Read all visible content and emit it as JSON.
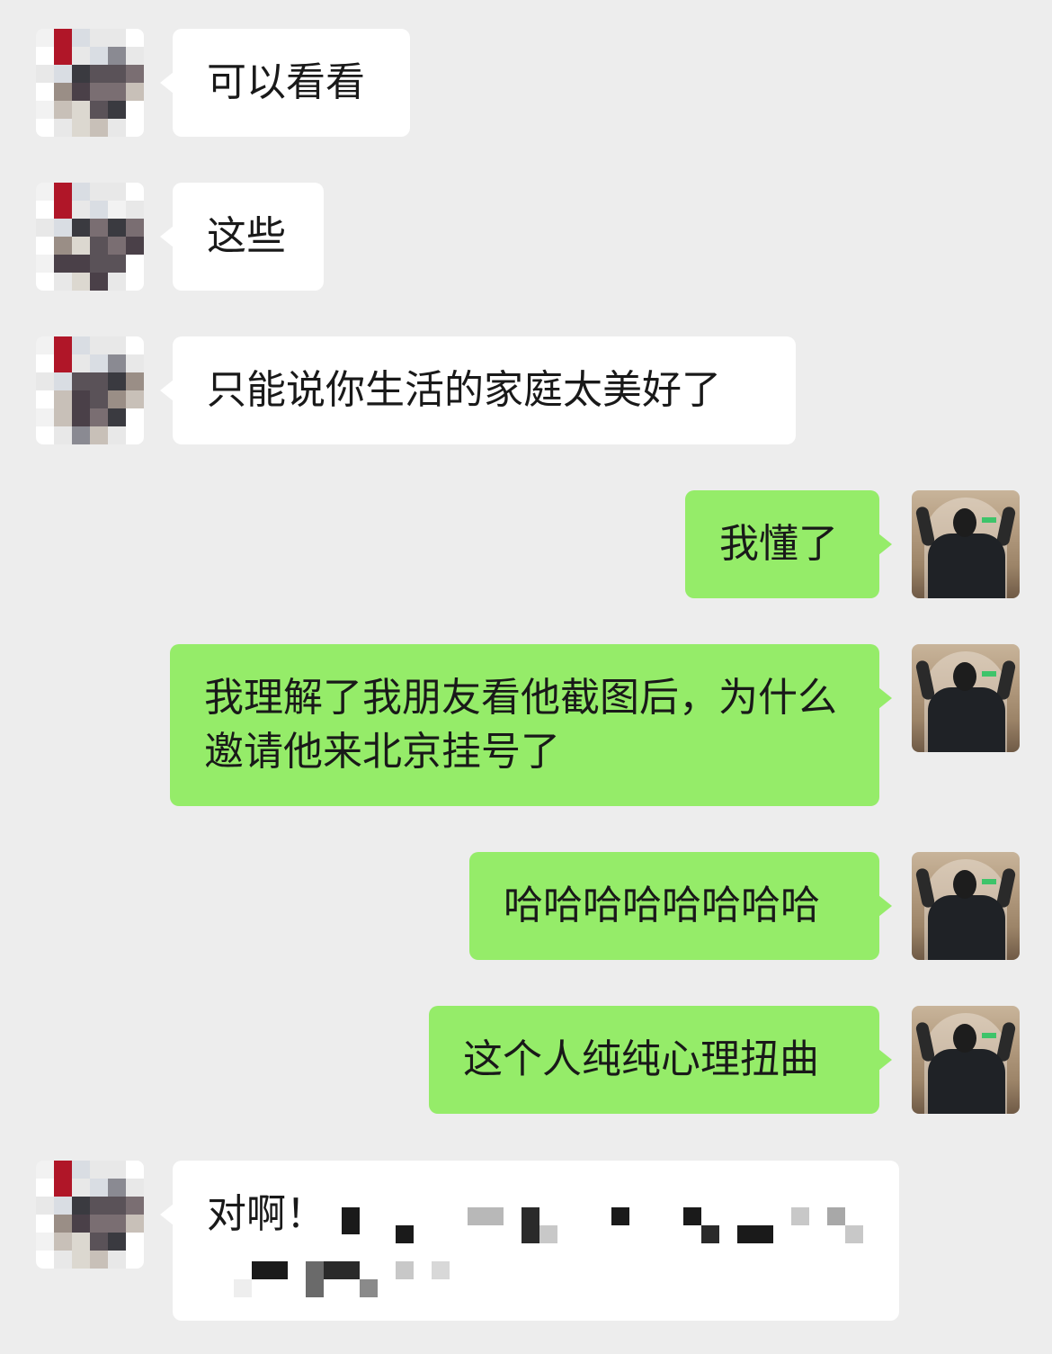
{
  "messages": [
    {
      "side": "left",
      "text": "可以看看"
    },
    {
      "side": "left",
      "text": "这些"
    },
    {
      "side": "left",
      "text": "只能说你生活的家庭太美好了"
    },
    {
      "side": "right",
      "text": "我懂了"
    },
    {
      "side": "right",
      "text": "我理解了我朋友看他截图后，为什么邀请他来北京挂号了"
    },
    {
      "side": "right",
      "text": "哈哈哈哈哈哈哈哈"
    },
    {
      "side": "right",
      "text": "这个人纯纯心理扭曲"
    },
    {
      "side": "left",
      "text": "对啊！"
    }
  ],
  "colors": {
    "background": "#ededed",
    "bubble_left": "#ffffff",
    "bubble_right": "#95ec69",
    "text": "#191919"
  },
  "icons": {
    "contact_avatar": "pixelated-avatar-icon",
    "self_avatar": "person-photo-avatar-icon"
  }
}
